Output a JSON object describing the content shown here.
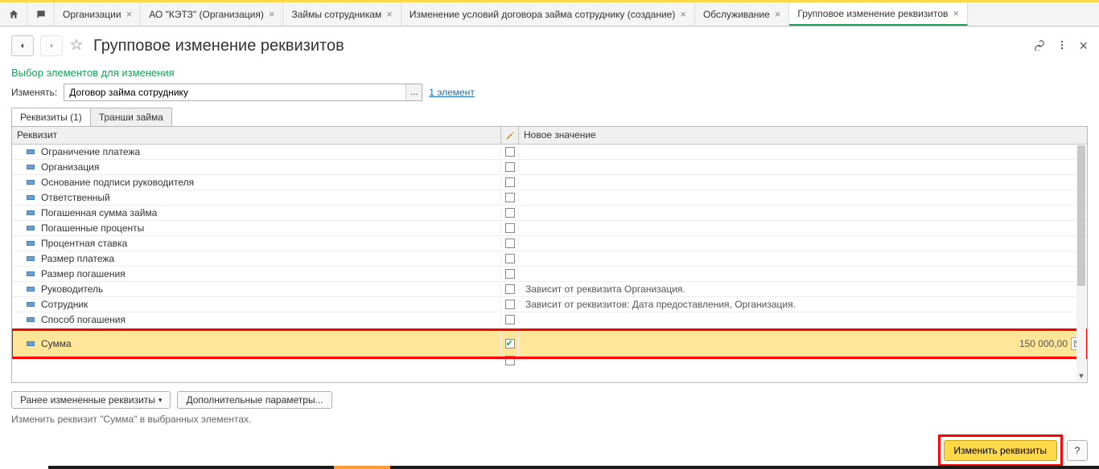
{
  "tabs": {
    "items": [
      {
        "label": "Организации",
        "closable": true
      },
      {
        "label": "АО \"КЭТЗ\" (Организация)",
        "closable": true
      },
      {
        "label": "Займы сотрудникам",
        "closable": true
      },
      {
        "label": "Изменение условий договора займа сотруднику (создание)",
        "closable": true
      },
      {
        "label": "Обслуживание",
        "closable": true
      },
      {
        "label": "Групповое изменение реквизитов",
        "closable": true,
        "active": true
      }
    ]
  },
  "page": {
    "title": "Групповое изменение реквизитов",
    "section_title": "Выбор элементов для изменения",
    "change_label": "Изменять:",
    "change_value": "Договор займа сотруднику",
    "count_link": "1 элемент"
  },
  "subtabs": {
    "tab1": "Реквизиты (1)",
    "tab2": "Транши займа"
  },
  "grid": {
    "col_rek": "Реквизит",
    "col_val": "Новое значение",
    "rows": [
      {
        "label": "Ограничение платежа",
        "checked": false,
        "value": ""
      },
      {
        "label": "Организация",
        "checked": false,
        "value": ""
      },
      {
        "label": "Основание подписи руководителя",
        "checked": false,
        "value": ""
      },
      {
        "label": "Ответственный",
        "checked": false,
        "value": ""
      },
      {
        "label": "Погашенная сумма займа",
        "checked": false,
        "value": ""
      },
      {
        "label": "Погашенные проценты",
        "checked": false,
        "value": ""
      },
      {
        "label": "Процентная ставка",
        "checked": false,
        "value": ""
      },
      {
        "label": "Размер платежа",
        "checked": false,
        "value": ""
      },
      {
        "label": "Размер погашения",
        "checked": false,
        "value": ""
      },
      {
        "label": "Руководитель",
        "checked": false,
        "value": "Зависит от реквизита Организация."
      },
      {
        "label": "Сотрудник",
        "checked": false,
        "value": "Зависит от реквизитов: Дата предоставления, Организация."
      },
      {
        "label": "Способ погашения",
        "checked": false,
        "value": ""
      }
    ],
    "highlight_row": {
      "label": "Сумма",
      "checked": true,
      "value": "150 000,00"
    }
  },
  "buttons": {
    "prev_changed": "Ранее измененные реквизиты",
    "extra_params": "Дополнительные параметры...",
    "apply": "Изменить реквизиты",
    "help": "?"
  },
  "status": "Изменить реквизит \"Сумма\" в выбранных элементах."
}
